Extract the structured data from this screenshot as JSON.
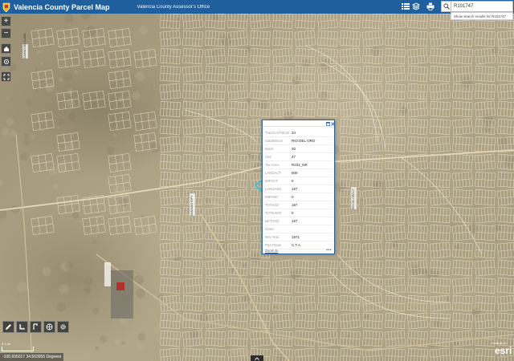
{
  "header": {
    "title": "Valencia County Parcel Map",
    "subtitle": "Valencia County Assessor's Office"
  },
  "search": {
    "value": "R101747",
    "hint": "Show search results for R101747"
  },
  "header_icons": [
    "layer-list-icon",
    "layers-icon",
    "print-icon",
    "search-icon"
  ],
  "toolbar": {
    "zoom_in_label": "+",
    "zoom_out_label": "−"
  },
  "popup": {
    "fields": [
      {
        "key": "Tract/Lot Parcel",
        "value": "34"
      },
      {
        "key": "Subdivision",
        "value": "RIO DEL ORO"
      },
      {
        "key": "Block",
        "value": "30"
      },
      {
        "key": "Unit",
        "value": "47"
      },
      {
        "key": "Tax Area",
        "value": "R231_NR"
      },
      {
        "key": "LANDACT",
        "value": "500"
      },
      {
        "key": "IMPACT",
        "value": "0"
      },
      {
        "key": "LANDASD",
        "value": "167"
      },
      {
        "key": "IMPASD",
        "value": "0"
      },
      {
        "key": "TOTASD",
        "value": "167"
      },
      {
        "key": "TOTEXMT",
        "value": "0"
      },
      {
        "key": "NETASD",
        "value": "167"
      },
      {
        "key": "Notes",
        "value": ""
      },
      {
        "key": "Rev Year",
        "value": "1971"
      },
      {
        "key": "Prpt Prpse",
        "value": "C.T.A."
      }
    ],
    "zoom_link": "Zoom to",
    "more": "•••"
  },
  "status": {
    "coordinates": "-106.695017 34.663955 Degrees",
    "scale_label": "0 1 mi"
  },
  "map_labels": [
    {
      "text": "MANZANO EXPY"
    },
    {
      "text": "RIO DEL ORO LP"
    },
    {
      "text": "CAMINO DEL LLANO"
    }
  ],
  "attribution": {
    "powered": "POWERED BY",
    "brand": "esri"
  },
  "colors": {
    "header": "#1f5f9e",
    "parcel_lines": "#e9e3d2",
    "popup_border": "#2e66a4",
    "selection": "#31c2d6"
  }
}
